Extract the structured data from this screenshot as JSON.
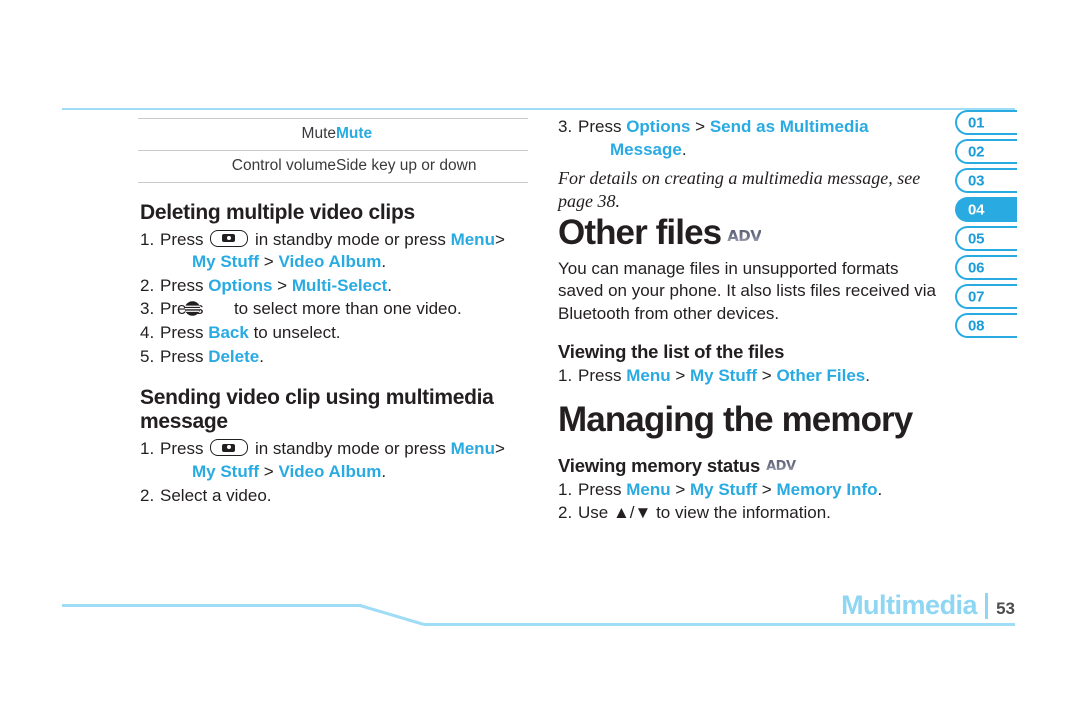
{
  "page": {
    "footer_section": "Multimedia",
    "footer_page_number": "53",
    "accent_color": "#29abe2",
    "rule_color": "#9fdcf5"
  },
  "tabs": {
    "active": "04",
    "items": [
      {
        "label": "01"
      },
      {
        "label": "02"
      },
      {
        "label": "03"
      },
      {
        "label": "04"
      },
      {
        "label": "05"
      },
      {
        "label": "06"
      },
      {
        "label": "07"
      },
      {
        "label": "08"
      }
    ]
  },
  "left_column": {
    "table": {
      "rows": [
        {
          "key": "Mute",
          "value": "Mute",
          "value_accent": true
        },
        {
          "key": "Control volume",
          "value": "Side key up or down",
          "value_accent": false
        }
      ]
    },
    "section_delete": {
      "heading": "Deleting multiple video clips",
      "steps": [
        {
          "num": "1.",
          "pre": "Press",
          "icon": "camera-key-icon",
          "mid": "in standby mode or press",
          "link1": "Menu",
          "sep1": ">",
          "cont_link1": "My Stuff",
          "cont_sep": ">",
          "cont_link2": "Video Album",
          "cont_end": "."
        },
        {
          "num": "2.",
          "pre": "Press",
          "link1": "Options",
          "sep1": ">",
          "link2": "Multi-Select",
          "end": "."
        },
        {
          "num": "3.",
          "pre": "Press",
          "icon": "att-globe-icon",
          "post": "to select more than one video."
        },
        {
          "num": "4.",
          "pre": "Press",
          "link1": "Back",
          "post": "to unselect."
        },
        {
          "num": "5.",
          "pre": "Press",
          "link1": "Delete",
          "end": "."
        }
      ]
    },
    "section_send": {
      "heading": "Sending video clip using multimedia message",
      "steps": [
        {
          "num": "1.",
          "pre": "Press",
          "icon": "camera-key-icon",
          "mid": "in standby mode or press",
          "link1": "Menu",
          "sep1": ">",
          "cont_link1": "My Stuff",
          "cont_sep": ">",
          "cont_link2": "Video Album",
          "cont_end": "."
        },
        {
          "num": "2.",
          "text": "Select a video."
        }
      ]
    }
  },
  "right_column": {
    "step3": {
      "num": "3.",
      "pre": "Press",
      "link1": "Options",
      "sep1": ">",
      "link2": "Send as Multimedia",
      "cont_link": "Message",
      "cont_end": "."
    },
    "note": "For details on creating a multimedia message, see page 38.",
    "other_files": {
      "heading": "Other files",
      "badge": "ADV",
      "body": "You can manage files in unsupported formats saved on your phone. It also lists files received via Bluetooth from other devices.",
      "sub_heading": "Viewing the list of the files",
      "step": {
        "num": "1.",
        "pre": "Press",
        "link1": "Menu",
        "sep1": ">",
        "link2": "My Stuff",
        "sep2": ">",
        "link3": "Other Files",
        "end": "."
      }
    },
    "managing_memory": {
      "heading": "Managing the memory",
      "sub_heading": "Viewing memory status",
      "badge": "ADV",
      "steps": [
        {
          "num": "1.",
          "pre": "Press",
          "link1": "Menu",
          "sep1": ">",
          "link2": "My Stuff",
          "sep2": ">",
          "link3": "Memory Info",
          "end": "."
        },
        {
          "num": "2.",
          "pre": "Use",
          "arrows": "▲/▼",
          "post": "to view the information."
        }
      ]
    }
  }
}
